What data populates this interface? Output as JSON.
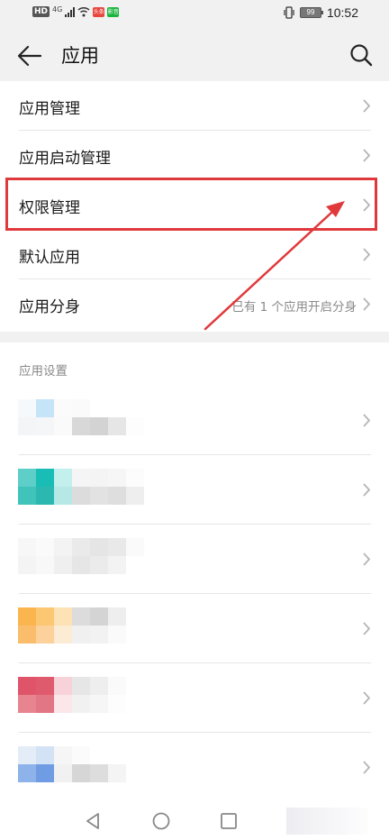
{
  "status_bar": {
    "hd": "HD",
    "network": "4G",
    "app_badge_1": "头条",
    "app_badge_2": "影音",
    "battery": "99",
    "time": "10:52"
  },
  "header": {
    "title": "应用",
    "back_icon": "arrow-left-icon",
    "search_icon": "search-icon"
  },
  "menu": {
    "items": [
      {
        "label": "应用管理"
      },
      {
        "label": "应用启动管理"
      },
      {
        "label": "权限管理"
      },
      {
        "label": "默认应用"
      },
      {
        "label": "应用分身",
        "sub": "已有 1 个应用开启分身"
      }
    ]
  },
  "app_settings": {
    "section_title": "应用设置"
  },
  "colors": {
    "highlight": "#e0393c",
    "background": "#f1f1f1",
    "secondary_text": "#8a8a8a"
  },
  "nav": {
    "back": "triangle-back-icon",
    "home": "circle-home-icon",
    "recent": "square-recent-icon"
  }
}
